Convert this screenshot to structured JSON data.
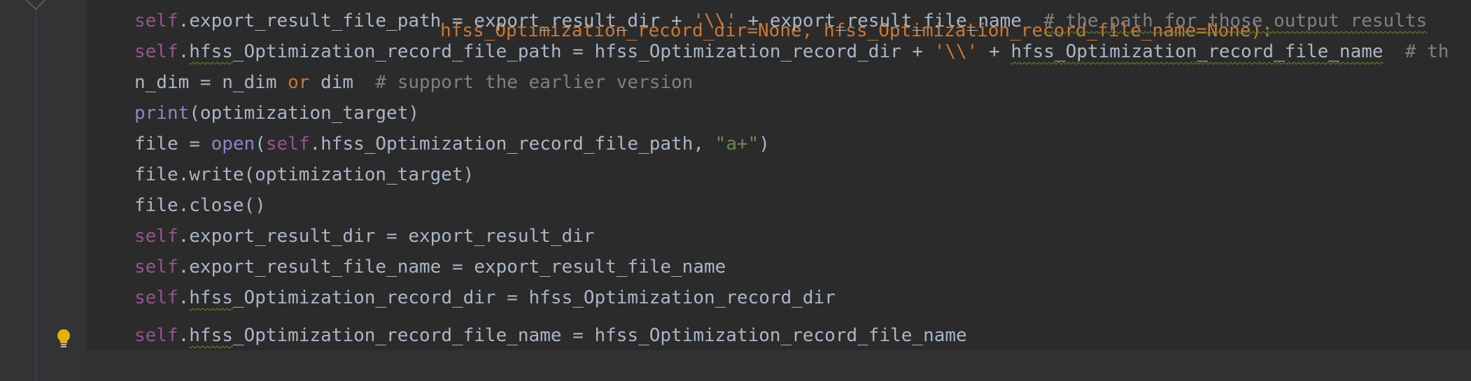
{
  "editor": {
    "lines": [
      {
        "parts": [
          "                hfss_Optimization_record_dir=None, hfss_Optimization_record_file_name=None):"
        ]
      },
      {
        "parts": [
          "self",
          ".export_result_file_path = export_result_dir + ",
          "'\\\\'",
          " + export_result_file_name  ",
          "# the path for those output results"
        ]
      },
      {
        "parts": [
          "self",
          ".",
          "hfss",
          "_Optimization_record_file_path = hfss_Optimization_record_dir + ",
          "'\\\\'",
          " + ",
          "hfss_Optimization_record_file_name",
          "  # th"
        ]
      },
      {
        "parts": [
          "n_dim = n_dim ",
          "or",
          " dim  ",
          "# support the earlier version"
        ]
      },
      {
        "parts": [
          "print",
          "(optimization_target)"
        ]
      },
      {
        "parts": [
          "file = ",
          "open",
          "(",
          "self",
          ".hfss_Optimization_record_file_path, ",
          "\"a+\"",
          ")"
        ]
      },
      {
        "parts": [
          "file.write(optimization_target)"
        ]
      },
      {
        "parts": [
          "file.close()"
        ]
      },
      {
        "parts": [
          "self",
          ".export_result_dir = export_result_dir"
        ]
      },
      {
        "parts": [
          "self",
          ".export_result_file_name = export_result_file_name"
        ]
      },
      {
        "parts": [
          "self",
          ".",
          "hfss",
          "_Optimization_record_dir = hfss_Optimization_record_dir"
        ]
      },
      {
        "parts": [
          "self",
          ".",
          "hfss",
          "_Optimization_record_file_name = hfss_Optimization_record_file_name"
        ]
      }
    ]
  },
  "icons": {
    "bulb": "lightbulb-icon",
    "fold": "fold-marker-icon"
  },
  "colors": {
    "background": "#2b2b2b",
    "gutter": "#313335",
    "text": "#a9b7c6",
    "self_keyword": "#94558d",
    "keyword": "#cc7832",
    "builtin": "#8888c6",
    "string": "#6a8759",
    "comment": "#808080",
    "bulb": "#e8b000"
  }
}
